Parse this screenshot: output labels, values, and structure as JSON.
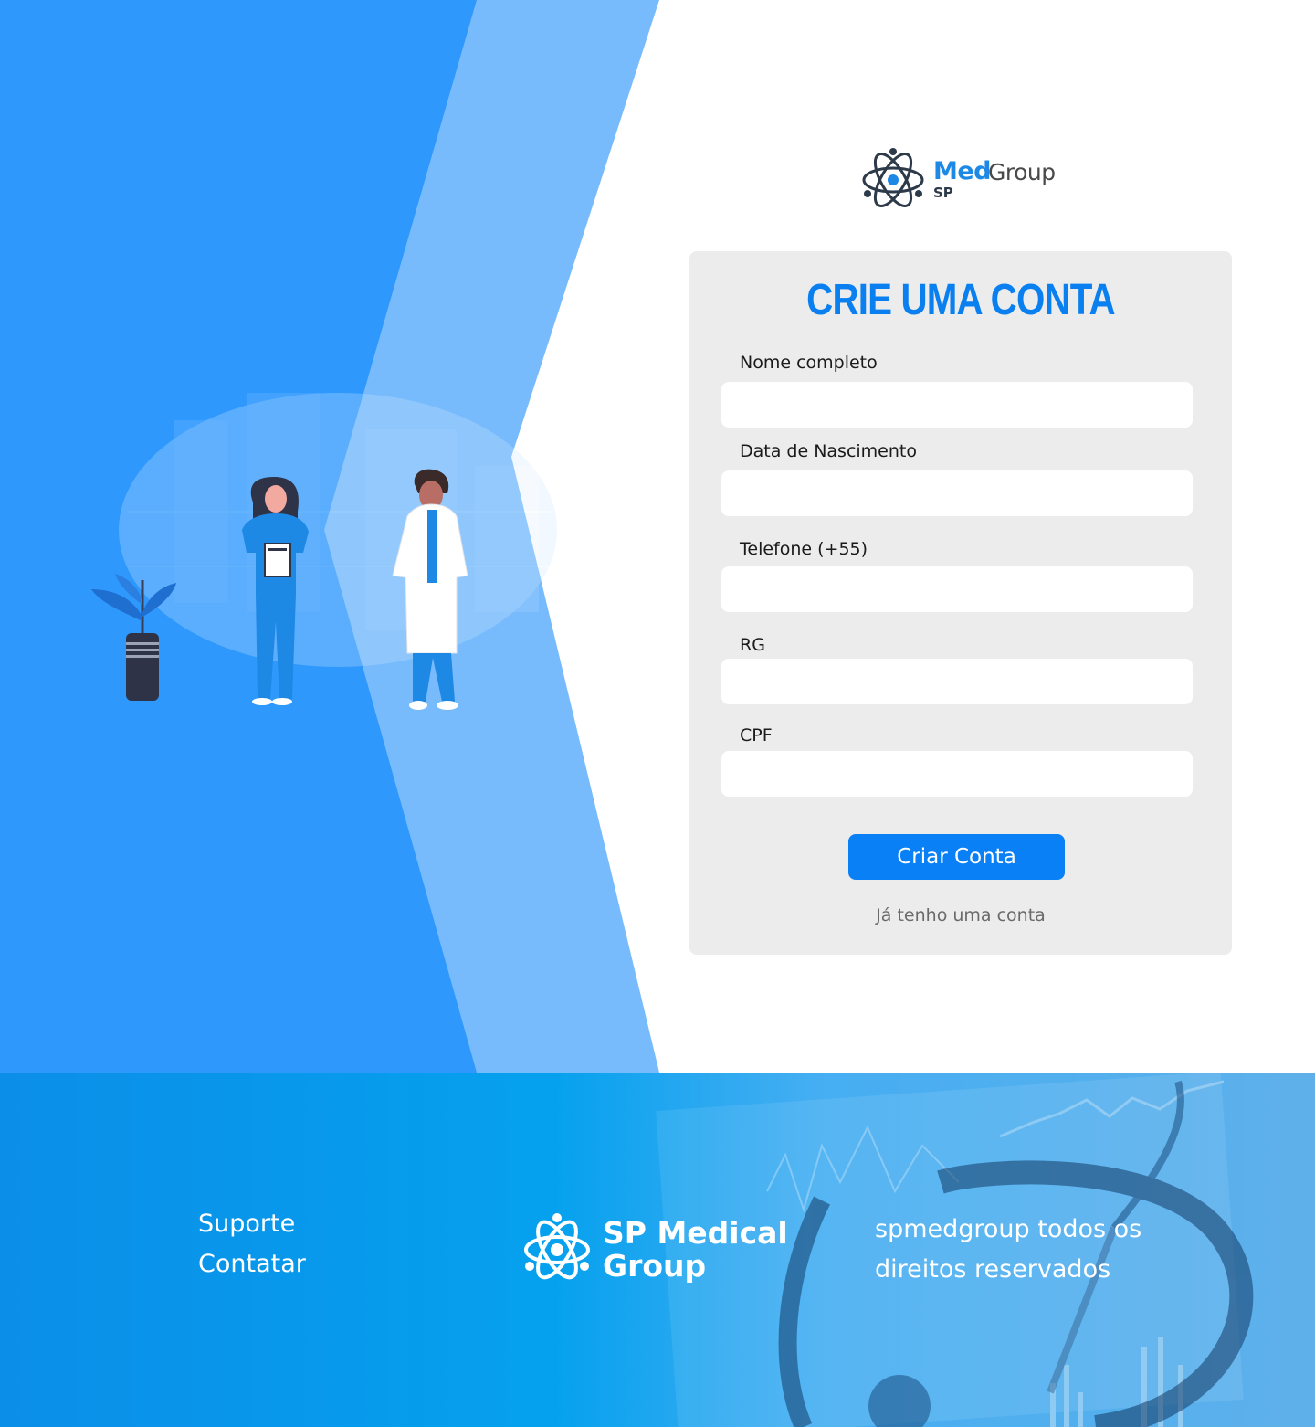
{
  "colors": {
    "primary_blue": "#2e98fd",
    "light_blue": "#77bbfd",
    "title_blue": "#0a7ff0",
    "button_blue": "#0a80f6",
    "card_gray": "#ececec",
    "footer_blue": "#05a1ee"
  },
  "brand": {
    "med": "Med",
    "group": "Group",
    "sp": "SP",
    "icon": "atom-icon"
  },
  "form": {
    "title": "CRIE UMA CONTA",
    "fields": [
      {
        "label": "Nome completo",
        "value": "",
        "placeholder": ""
      },
      {
        "label": "Data de Nascimento",
        "value": "",
        "placeholder": ""
      },
      {
        "label": "Telefone (+55)",
        "value": "",
        "placeholder": ""
      },
      {
        "label": "RG",
        "value": "",
        "placeholder": ""
      },
      {
        "label": "CPF",
        "value": "",
        "placeholder": ""
      }
    ],
    "submit_label": "Criar Conta",
    "login_link": "Já tenho uma conta"
  },
  "illustration": {
    "icons": [
      "plant-icon",
      "nurse-icon",
      "doctor-icon",
      "hospital-building-icon"
    ]
  },
  "footer": {
    "links": [
      "Suporte",
      "Contatar"
    ],
    "brand_line1": "SP Medical",
    "brand_line2": "Group",
    "copyright": "spmedgroup todos os direitos reservados",
    "background_icons": [
      "stethoscope-icon",
      "line-chart-icon"
    ]
  }
}
